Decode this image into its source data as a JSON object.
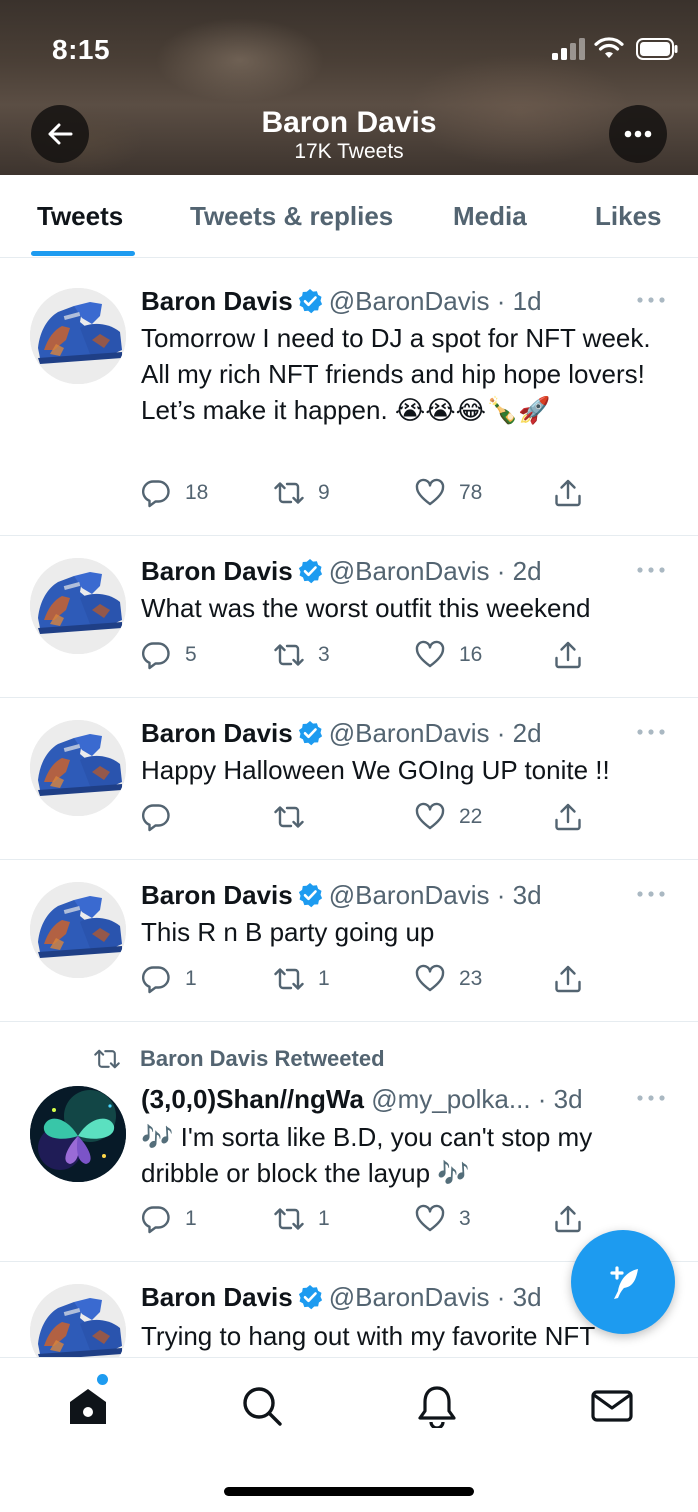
{
  "status_bar": {
    "time": "8:15"
  },
  "profile": {
    "name": "Baron Davis",
    "tweet_count": "17K Tweets"
  },
  "tabs": [
    {
      "label": "Tweets",
      "active": true
    },
    {
      "label": "Tweets & replies",
      "active": false
    },
    {
      "label": "Media",
      "active": false
    },
    {
      "label": "Likes",
      "active": false
    }
  ],
  "tweets": [
    {
      "name": "Baron Davis",
      "verified": true,
      "handle": "@BaronDavis",
      "time": "· 1d",
      "text": "Tomorrow I need to DJ a spot for NFT week.  All my rich NFT friends and hip hope lovers! Let’s make it happen. 😭😭😂🍾🚀",
      "replies": "18",
      "retweets": "9",
      "likes": "78"
    },
    {
      "name": "Baron Davis",
      "verified": true,
      "handle": "@BaronDavis",
      "time": "· 2d",
      "text": "What was the worst outfit this weekend",
      "replies": "5",
      "retweets": "3",
      "likes": "16"
    },
    {
      "name": "Baron Davis",
      "verified": true,
      "handle": "@BaronDavis",
      "time": "· 2d",
      "text": "Happy Halloween We GOIng UP tonite !!",
      "replies": "",
      "retweets": "",
      "likes": "22"
    },
    {
      "name": "Baron Davis",
      "verified": true,
      "handle": "@BaronDavis",
      "time": "· 3d",
      "text": "This R n B party going up",
      "replies": "1",
      "retweets": "1",
      "likes": "23"
    },
    {
      "retweeted_by": "Baron Davis Retweeted",
      "name": "(3,0,0)Shan//ngWa",
      "verified": false,
      "handle": "@my_polka...",
      "time": " · 3d",
      "text": "🎶 I'm sorta like B.D, you can't stop my dribble or block the layup 🎶",
      "replies": "1",
      "retweets": "1",
      "likes": "3"
    },
    {
      "name": "Baron Davis",
      "verified": true,
      "handle": "@BaronDavis",
      "time": "· 3d",
      "text": "Trying to hang out with my favorite NFT"
    }
  ],
  "icons": {
    "back": "arrow-left-icon",
    "more": "more-horizontal-icon",
    "reply": "reply-icon",
    "retweet": "retweet-icon",
    "like": "heart-icon",
    "share": "share-icon",
    "compose": "compose-tweet-icon",
    "home": "home-icon",
    "search": "search-icon",
    "notifications": "bell-icon",
    "messages": "mail-icon"
  },
  "colors": {
    "accent": "#1d9bf0",
    "text": "#0f1419",
    "secondary": "#536471"
  }
}
